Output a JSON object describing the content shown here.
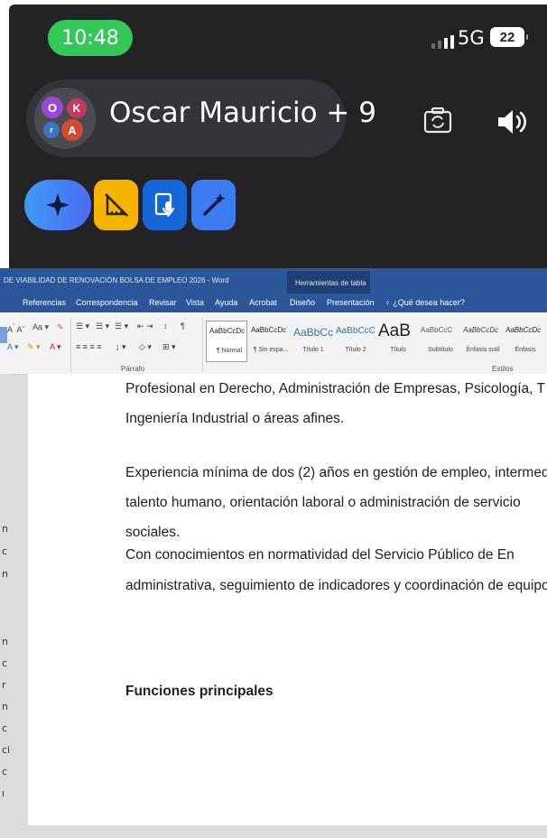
{
  "status_bar": {
    "time": "10:48",
    "network": "5G",
    "battery": "22"
  },
  "call": {
    "caller_name": "Oscar Mauricio + 9",
    "avatars": [
      {
        "initial": "O",
        "color": "#9b48d4"
      },
      {
        "initial": "K",
        "color": "#c23c5e"
      },
      {
        "initial": "r",
        "color": "#3a74c7"
      },
      {
        "initial": "A",
        "color": "#d24b33"
      }
    ],
    "icons": [
      "camera-flip-icon",
      "speaker-icon",
      "sparkle-ai-icon",
      "crossed-ruler-icon",
      "mic-document-icon",
      "magic-wand-icon"
    ]
  },
  "word": {
    "title": "DE VIABILIDAD DE RENOVACIÓN BOLSA DE EMPLEO 2026  -  Word",
    "context_tab": "Herramientas de tabla",
    "tabs": [
      "Referencias",
      "Correspondencia",
      "Revisar",
      "Vista",
      "Ayuda",
      "Acrobat",
      "Diseño",
      "Presentación"
    ],
    "tell_me": "¿Qué desea hacer?",
    "paragraph_group": "Párrafo",
    "styles_group": "Estilos",
    "styles": [
      {
        "sample": "AaBbCcDc",
        "name": "¶ Normal"
      },
      {
        "sample": "AaBbCcDc",
        "name": "¶ Sin espa..."
      },
      {
        "sample": "AaBbCc",
        "name": "Título 1"
      },
      {
        "sample": "AaBbCcC",
        "name": "Título 2"
      },
      {
        "sample": "AaB",
        "name": "Título"
      },
      {
        "sample": "AaBbCcC",
        "name": "Subtítulo"
      },
      {
        "sample": "AaBbCcDc",
        "name": "Énfasis sutil"
      },
      {
        "sample": "AaBbCcDc",
        "name": "Énfasis"
      }
    ],
    "accent_color": "#2b579a"
  },
  "document": {
    "lines": [
      "Profesional en Derecho, Administración de Empresas, Psicología, T",
      "Ingeniería Industrial o áreas afines.",
      "Experiencia mínima de dos (2) años en gestión de empleo, intermed",
      "talento humano, orientación laboral o administración de servicio",
      "sociales.",
      "Con conocimientos en normatividad del Servicio Público de En",
      "administrativa, seguimiento de indicadores y coordinación de equipo"
    ],
    "heading": "Funciones principales",
    "left_margin_chars": [
      "n",
      "c",
      "n",
      "n",
      "c",
      "r",
      "n",
      "c",
      "ci",
      "c",
      "ı"
    ]
  }
}
